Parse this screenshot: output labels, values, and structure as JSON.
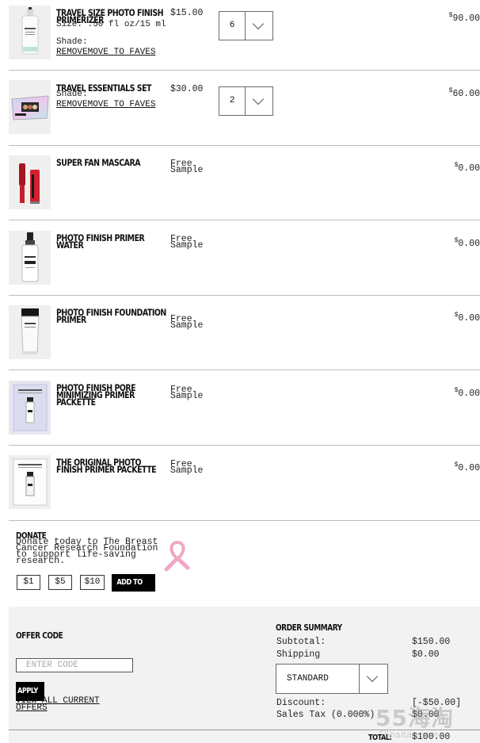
{
  "currency_symbol": "$",
  "items": [
    {
      "name": "TRAVEL SIZE PHOTO FINISH PRIMERIZER",
      "size": "Size: .50 fl oz/15 ml",
      "shade": "Shade:",
      "actions": "REMOVEMOVE TO FAVES",
      "unit_price": "$15.00",
      "quantity": "6",
      "total": "90.00",
      "product_image": "white-primer-bottle"
    },
    {
      "name": "TRAVEL ESSENTIALS SET",
      "size": "",
      "shade": "Shade:",
      "actions": "REMOVEMOVE TO FAVES",
      "unit_price": "$30.00",
      "quantity": "2",
      "total": "60.00",
      "product_image": "holographic-travel-set"
    },
    {
      "name": "SUPER FAN MASCARA",
      "unit_price": "Free Sample",
      "total": "0.00",
      "product_image": "red-mascara"
    },
    {
      "name": "PHOTO FINISH PRIMER WATER",
      "unit_price": "Free Sample",
      "total": "0.00",
      "product_image": "primer-water-bottle"
    },
    {
      "name": "PHOTO FINISH FOUNDATION PRIMER",
      "unit_price": "Free Sample",
      "total": "0.00",
      "product_image": "primer-tube"
    },
    {
      "name": "PHOTO FINISH PORE MINIMIZING PRIMER PACKETTE",
      "unit_price": "Free Sample",
      "total": "0.00",
      "product_image": "primer-packette"
    },
    {
      "name": "THE ORIGINAL PHOTO FINISH PRIMER PACKETTE",
      "unit_price": "Free Sample",
      "total": "0.00",
      "product_image": "primer-packette-white"
    }
  ],
  "donate": {
    "title": "DONATE",
    "text": "Donate today to The Breast Cancer Research Foundation to support life-saving research.",
    "amounts": [
      "$1",
      "$5",
      "$10"
    ],
    "add_button": "ADD TO BAG",
    "ribbon_icon": "pink-ribbon-icon"
  },
  "offer": {
    "title": "OFFER CODE",
    "placeholder": "ENTER CODE",
    "apply": "APPLY",
    "view_all": "VIEW ALL CURRENT OFFERS"
  },
  "summary": {
    "title": "ORDER SUMMARY",
    "subtotal_label": "Subtotal:",
    "subtotal": "$150.00",
    "shipping_label": "Shipping",
    "shipping": "$0.00",
    "shipping_method": "STANDARD",
    "discount_label": "Discount:",
    "discount": "[-$50.00]",
    "tax_label": "Sales Tax (0.000%)",
    "tax": "$0.00",
    "total_label": "TOTAL:",
    "total": "$100.00"
  },
  "watermark": {
    "big": "55海淘",
    "small": "55haitao.com"
  },
  "colors": {
    "panel": "#f2f2f2",
    "ribbon": "#f0a7c6",
    "button": "#000000"
  }
}
